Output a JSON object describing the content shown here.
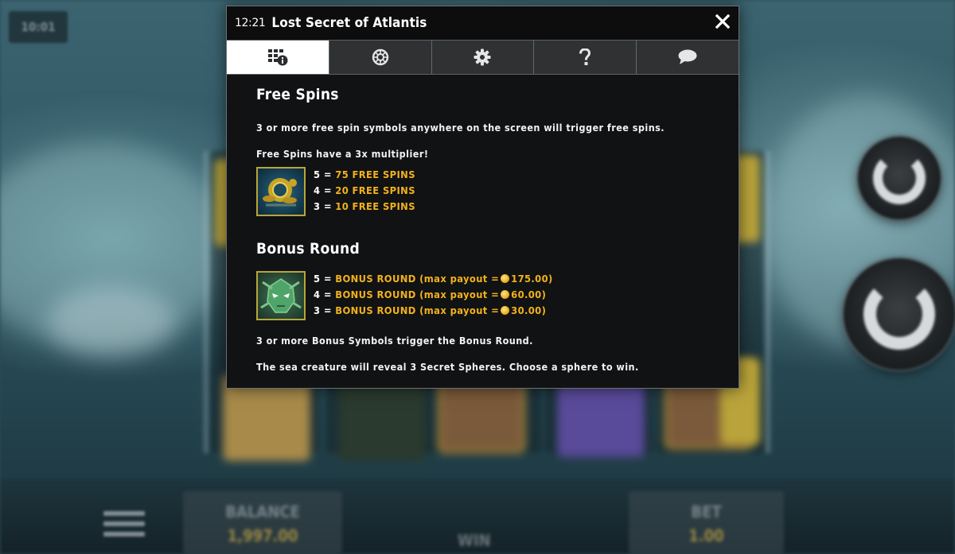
{
  "background": {
    "clock": "10:01",
    "balance_label": "BALANCE",
    "balance_value": "1,997.00",
    "win_label": "WIN",
    "bet_label": "BET",
    "bet_value": "1.00"
  },
  "modal": {
    "time": "12:21",
    "title": "Lost Secret of Atlantis",
    "close_icon": "close-icon",
    "tabs": [
      {
        "icon": "paytable-info-icon",
        "active": true
      },
      {
        "icon": "reel-wheel-icon",
        "active": false
      },
      {
        "icon": "gear-icon",
        "active": false
      },
      {
        "icon": "question-icon",
        "active": false
      },
      {
        "icon": "chat-icon",
        "active": false
      }
    ],
    "free_spins": {
      "title": "Free Spins",
      "trigger_text": "3 or more free spin symbols anywhere on the screen will trigger free spins.",
      "multiplier_text": "Free Spins have a 3x multiplier!",
      "symbol_icon": "diving-helmet-symbol",
      "payouts": [
        {
          "count": "5 =",
          "reward": "75 FREE SPINS"
        },
        {
          "count": "4 =",
          "reward": "20 FREE SPINS"
        },
        {
          "count": "3 =",
          "reward": "10 FREE SPINS"
        }
      ]
    },
    "bonus_round": {
      "title": "Bonus Round",
      "symbol_icon": "sea-creature-mask-symbol",
      "payouts": [
        {
          "count": "5 =",
          "reward": "BONUS ROUND (max payout =",
          "amount": "175.00)"
        },
        {
          "count": "4 =",
          "reward": "BONUS ROUND (max payout =",
          "amount": "60.00)"
        },
        {
          "count": "3 =",
          "reward": "BONUS ROUND (max payout =",
          "amount": "30.00)"
        }
      ],
      "trigger_text": "3 or more Bonus Symbols trigger the Bonus Round.",
      "reveal_text": "The sea creature will reveal 3 Secret Spheres. Choose a sphere to win."
    }
  },
  "colors": {
    "accent_gold": "#f2b21c",
    "modal_bg": "#111213",
    "tab_bg": "#2f3133",
    "tab_active_bg": "#ffffff"
  }
}
